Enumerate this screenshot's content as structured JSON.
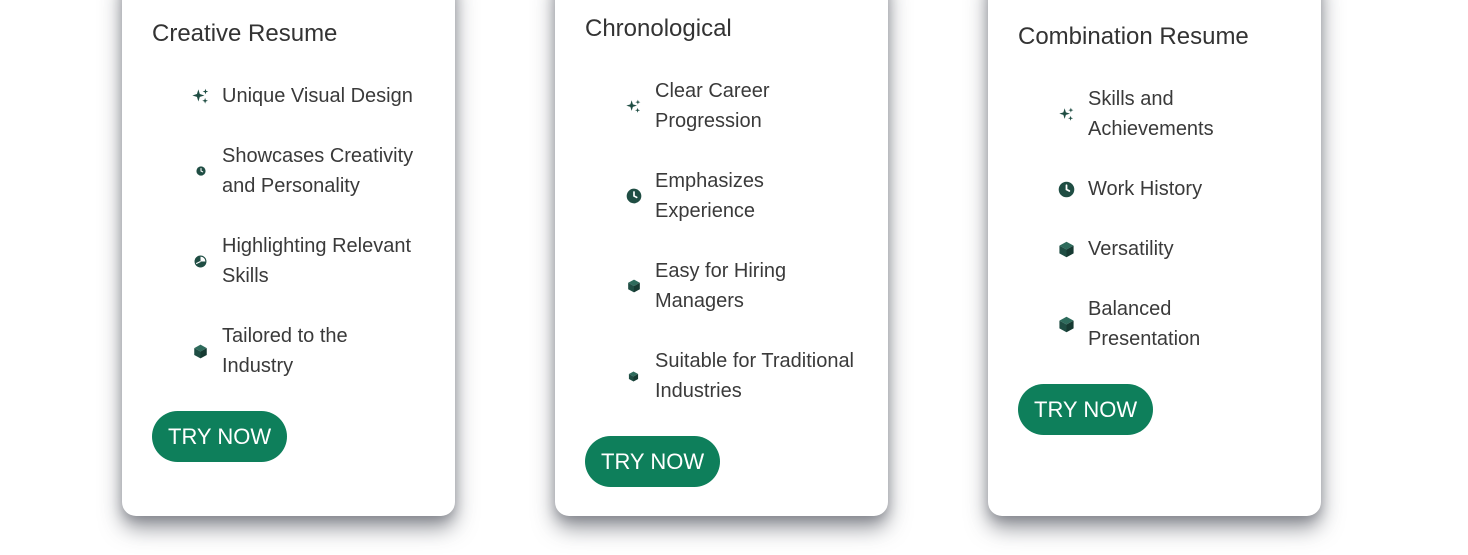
{
  "accent_color": "#0e7f5b",
  "icon_color": "#1f4d43",
  "cards": [
    {
      "title": "Creative Resume",
      "features": [
        {
          "icon": "sparkles-icon",
          "label": "Unique Visual Design"
        },
        {
          "icon": "clock-icon",
          "label": "Showcases Creativity and Personality"
        },
        {
          "icon": "chart-pie-icon",
          "label": "Highlighting Relevant Skills"
        },
        {
          "icon": "cube-icon",
          "label": "Tailored to the Industry"
        }
      ],
      "button_label": "TRY NOW"
    },
    {
      "title": "Chronological",
      "features": [
        {
          "icon": "sparkles-icon",
          "label": "Clear Career Progression"
        },
        {
          "icon": "clock-icon",
          "label": "Emphasizes Experience"
        },
        {
          "icon": "cube-icon",
          "label": "Easy for Hiring Managers"
        },
        {
          "icon": "cube-icon",
          "label": "Suitable for Traditional Industries"
        }
      ],
      "button_label": "TRY NOW"
    },
    {
      "title": "Combination Resume",
      "features": [
        {
          "icon": "sparkles-icon",
          "label": "Skills and Achievements"
        },
        {
          "icon": "clock-icon",
          "label": "Work History"
        },
        {
          "icon": "cube-icon",
          "label": "Versatility"
        },
        {
          "icon": "cube-icon",
          "label": "Balanced Presentation"
        }
      ],
      "button_label": "TRY NOW"
    }
  ]
}
